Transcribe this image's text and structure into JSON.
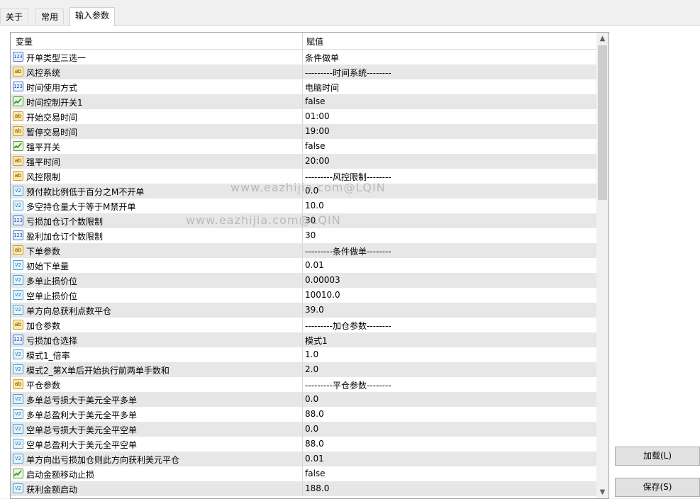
{
  "tabs": [
    "关于",
    "常用",
    "输入参数"
  ],
  "table": {
    "columns": [
      "变量",
      "赋值"
    ],
    "rows": [
      {
        "type": "int",
        "name": "开单类型三选一",
        "value": "条件做单"
      },
      {
        "type": "str",
        "name": "风控系统",
        "value": "---------时间系统--------"
      },
      {
        "type": "int",
        "name": "时间使用方式",
        "value": "电脑时间"
      },
      {
        "type": "bool",
        "name": "时间控制开关1",
        "value": "false"
      },
      {
        "type": "str",
        "name": "开始交易时间",
        "value": "01:00"
      },
      {
        "type": "str",
        "name": "暂停交易时间",
        "value": "19:00"
      },
      {
        "type": "bool",
        "name": "强平开关",
        "value": "false"
      },
      {
        "type": "str",
        "name": "强平时间",
        "value": "20:00"
      },
      {
        "type": "str",
        "name": "风控限制",
        "value": "---------风控限制--------"
      },
      {
        "type": "dbl",
        "name": "预付款比例低于百分之M不开单",
        "value": "0.0"
      },
      {
        "type": "dbl",
        "name": "多空持仓量大于等于M禁开单",
        "value": "10.0"
      },
      {
        "type": "int",
        "name": "亏损加仓订个数限制",
        "value": "30"
      },
      {
        "type": "int",
        "name": "盈利加仓订个数限制",
        "value": "30"
      },
      {
        "type": "str",
        "name": "下单参数",
        "value": "---------条件做单--------"
      },
      {
        "type": "dbl",
        "name": "初始下单量",
        "value": "0.01"
      },
      {
        "type": "dbl",
        "name": "多单止损价位",
        "value": "0.00003"
      },
      {
        "type": "dbl",
        "name": "空单止损价位",
        "value": "10010.0"
      },
      {
        "type": "dbl",
        "name": "单方向总获利点数平仓",
        "value": "39.0"
      },
      {
        "type": "str",
        "name": "加仓参数",
        "value": "---------加仓参数--------"
      },
      {
        "type": "int",
        "name": "亏损加仓选择",
        "value": "模式1"
      },
      {
        "type": "dbl",
        "name": "模式1_倍率",
        "value": "1.0"
      },
      {
        "type": "dbl",
        "name": "模式2_第X单后开始执行前两单手数和",
        "value": "2.0"
      },
      {
        "type": "str",
        "name": "平仓参数",
        "value": "---------平仓参数--------"
      },
      {
        "type": "dbl",
        "name": "多单总亏损大于美元全平多单",
        "value": "0.0"
      },
      {
        "type": "dbl",
        "name": "多单总盈利大于美元全平多单",
        "value": "88.0"
      },
      {
        "type": "dbl",
        "name": "空单总亏损大于美元全平空单",
        "value": "0.0"
      },
      {
        "type": "dbl",
        "name": "空单总盈利大于美元全平空单",
        "value": "88.0"
      },
      {
        "type": "dbl",
        "name": "单方向出亏损加仓则此方向获利美元平仓",
        "value": "0.01"
      },
      {
        "type": "bool",
        "name": "启动金额移动止损",
        "value": "false"
      },
      {
        "type": "dbl",
        "name": "获利金额启动",
        "value": "188.0"
      }
    ]
  },
  "icons": {
    "int": "123",
    "str": "ab",
    "dbl": "V2"
  },
  "scrollbar": {
    "thumb_fraction": 0.35
  },
  "buttons": {
    "load": "加载(L)",
    "save": "保存(S)"
  },
  "watermarks": [
    "www.eazhijia.com@LQIN",
    "www.eazhijia.com@LQIN"
  ]
}
